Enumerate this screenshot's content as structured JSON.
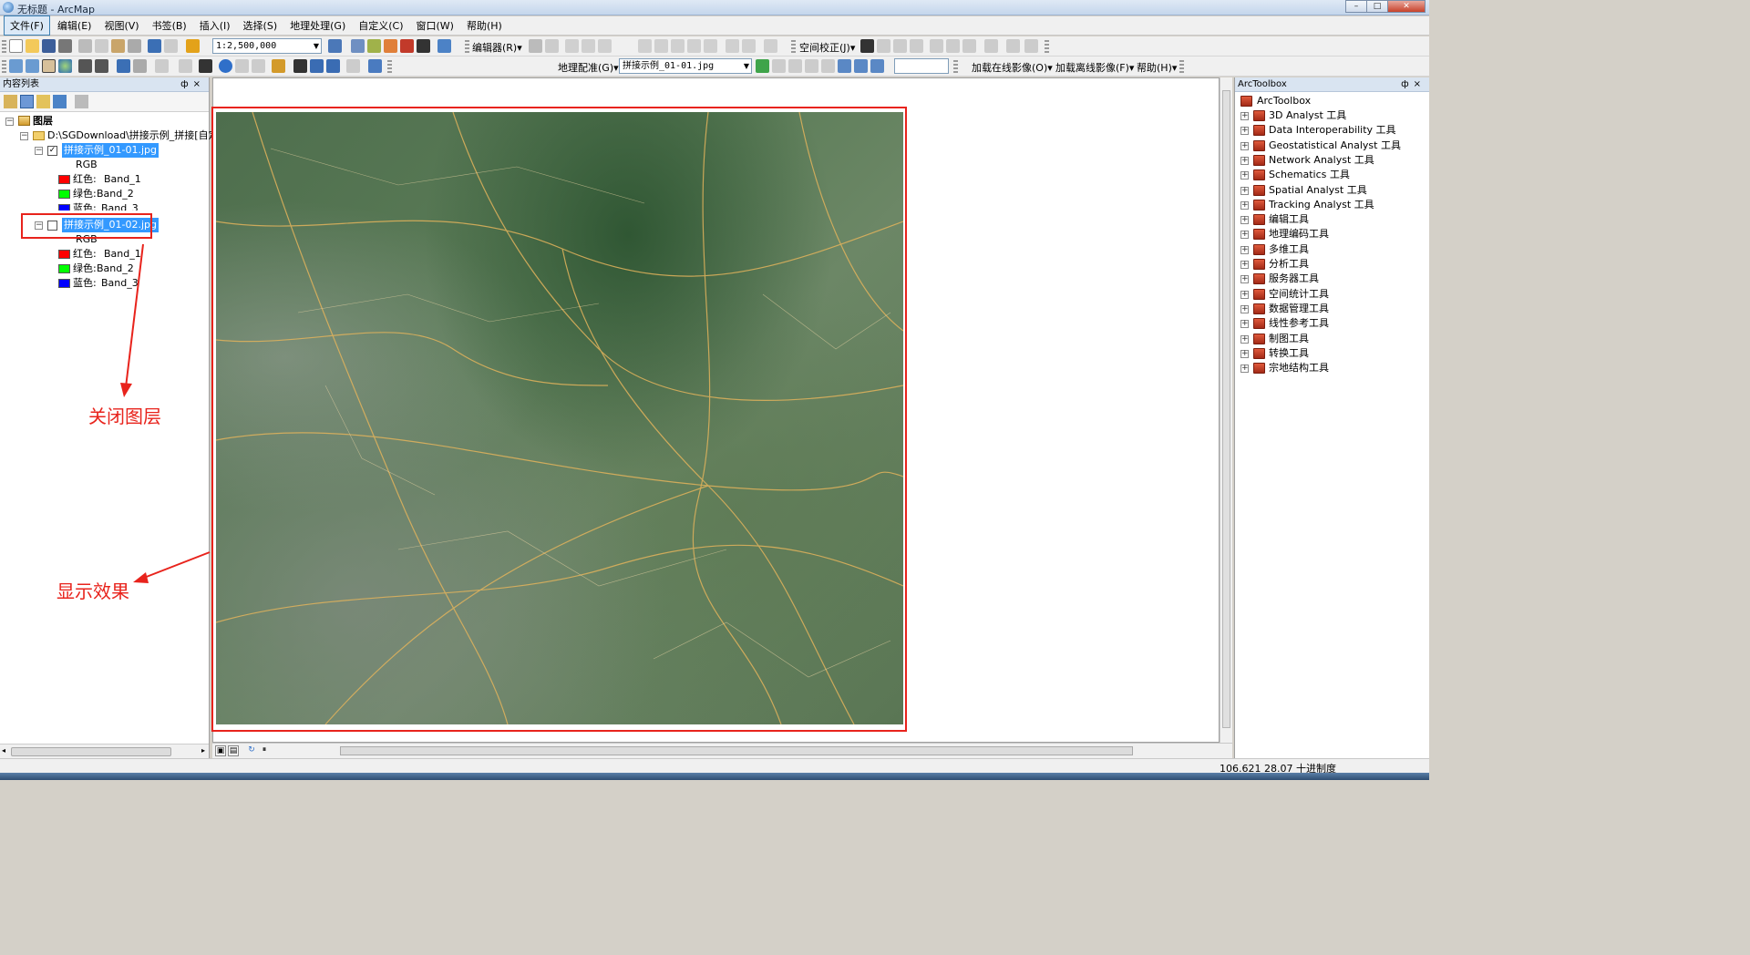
{
  "window": {
    "title": "无标题 - ArcMap",
    "buttons": [
      "–",
      "□",
      "✕"
    ]
  },
  "menu": [
    "文件(F)",
    "编辑(E)",
    "视图(V)",
    "书签(B)",
    "插入(I)",
    "选择(S)",
    "地理处理(G)",
    "自定义(C)",
    "窗口(W)",
    "帮助(H)"
  ],
  "toolbar1": {
    "scale": "1:2,500,000",
    "editor_label": "编辑器(R)▾",
    "spatial_adjust_label": "空间校正(J)▾"
  },
  "toolbar2": {
    "georef_label": "地理配准(G)▾",
    "georef_layer": "拼接示例_01-01.jpg",
    "load_online_label": "加载在线影像(O)▾",
    "load_offline_label": "加载离线影像(F)▾",
    "help_label": "帮助(H)▾"
  },
  "toc": {
    "header": "内容列表",
    "root": "图层",
    "folder": "D:\\SGDownload\\拼接示例_拼接[自定义",
    "layers": [
      {
        "name": "拼接示例_01-01.jpg",
        "checked": "✓",
        "render": "RGB",
        "bands": [
          {
            "label": "红色:",
            "band": "Band_1",
            "color": "#ff0000"
          },
          {
            "label": "绿色:",
            "band": "Band_2",
            "color": "#00ff00"
          },
          {
            "label": "蓝色:",
            "band": "Band_3",
            "color": "#0000ff"
          }
        ]
      },
      {
        "name": "拼接示例_01-02.jpg",
        "checked": "",
        "render": "RGB",
        "bands": [
          {
            "label": "红色:",
            "band": "Band_1",
            "color": "#ff0000"
          },
          {
            "label": "绿色:",
            "band": "Band_2",
            "color": "#00ff00"
          },
          {
            "label": "蓝色:",
            "band": "Band_3",
            "color": "#0000ff"
          }
        ]
      }
    ]
  },
  "annotations": {
    "close_layer": "关闭图层",
    "display_effect": "显示效果",
    "color": "#e8231c"
  },
  "toolbox": {
    "header": "ArcToolbox",
    "root": "ArcToolbox",
    "items": [
      "3D Analyst 工具",
      "Data Interoperability 工具",
      "Geostatistical Analyst 工具",
      "Network Analyst 工具",
      "Schematics 工具",
      "Spatial Analyst 工具",
      "Tracking Analyst 工具",
      "编辑工具",
      "地理编码工具",
      "多维工具",
      "分析工具",
      "服务器工具",
      "空间统计工具",
      "数据管理工具",
      "线性参考工具",
      "制图工具",
      "转换工具",
      "宗地结构工具"
    ]
  },
  "status": {
    "coords": "106.621  28.07 十进制度"
  }
}
